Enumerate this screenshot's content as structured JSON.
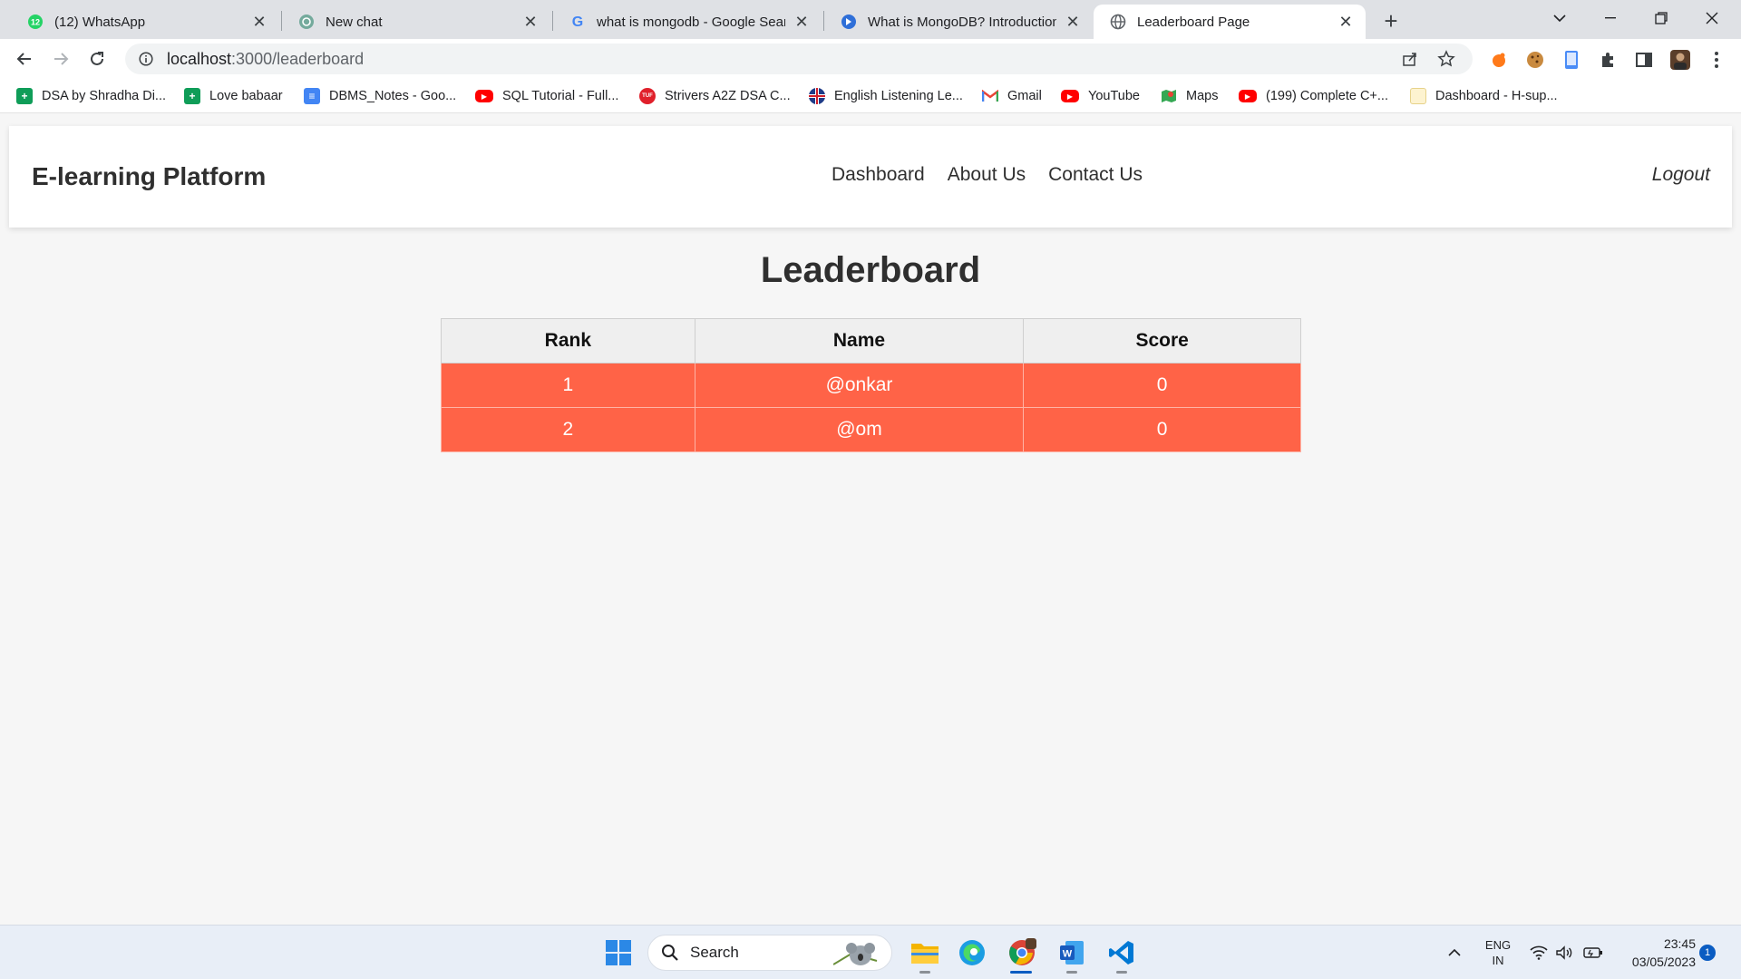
{
  "browser": {
    "tabs": [
      {
        "title": "(12) WhatsApp",
        "icon": "whatsapp-icon",
        "badge": "12"
      },
      {
        "title": "New chat",
        "icon": "chatgpt-icon"
      },
      {
        "title": "what is mongodb - Google Searc",
        "icon": "google-icon"
      },
      {
        "title": "What is MongoDB? Introduction,",
        "icon": "site-globe-icon"
      },
      {
        "title": "Leaderboard Page",
        "icon": "globe-icon",
        "active": true
      }
    ],
    "address": {
      "host": "localhost",
      "rest": ":3000/leaderboard"
    },
    "bookmarks": [
      {
        "label": "DSA by Shradha Di...",
        "icon": "sheets-icon",
        "color": "#0f9d58"
      },
      {
        "label": "Love babaar",
        "icon": "sheets-icon",
        "color": "#0f9d58"
      },
      {
        "label": "DBMS_Notes - Goo...",
        "icon": "docs-icon",
        "color": "#4285f4"
      },
      {
        "label": "SQL Tutorial - Full...",
        "icon": "youtube-icon",
        "color": "#ff0000"
      },
      {
        "label": "Strivers A2Z DSA C...",
        "icon": "tuf-icon",
        "color": "#e0202b"
      },
      {
        "label": "English Listening Le...",
        "icon": "uk-flag-icon",
        "color": "#1f3c88"
      },
      {
        "label": "Gmail",
        "icon": "gmail-icon",
        "color": "#ea4335"
      },
      {
        "label": "YouTube",
        "icon": "youtube-icon",
        "color": "#ff0000"
      },
      {
        "label": "Maps",
        "icon": "maps-icon",
        "color": "#34a853"
      },
      {
        "label": "(199) Complete C+...",
        "icon": "youtube-icon",
        "color": "#ff0000"
      },
      {
        "label": "Dashboard - H-sup...",
        "icon": "dashboard-icon",
        "color": "#f4c542"
      }
    ]
  },
  "app": {
    "brand": "E-learning Platform",
    "nav": [
      "Dashboard",
      "About Us",
      "Contact Us"
    ],
    "logout": "Logout"
  },
  "leaderboard": {
    "title": "Leaderboard",
    "headers": [
      "Rank",
      "Name",
      "Score"
    ],
    "rows": [
      [
        "1",
        "@onkar",
        "0"
      ],
      [
        "2",
        "@om",
        "0"
      ]
    ],
    "row_color": "#ff6347"
  },
  "taskbar": {
    "search_placeholder": "Search",
    "lang": "ENG",
    "region": "IN",
    "time": "23:45",
    "date": "03/05/2023",
    "notifications": "1"
  }
}
